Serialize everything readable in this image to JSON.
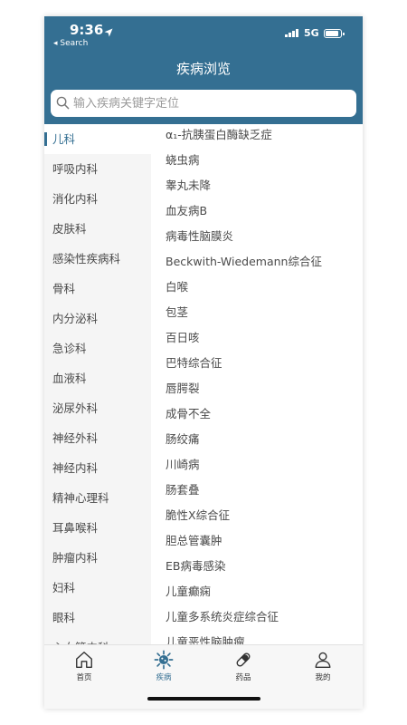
{
  "status_bar": {
    "time": "9:36",
    "back_app": "◂ Search",
    "network": "5G"
  },
  "header": {
    "title": "疾病浏览",
    "search": {
      "placeholder": "输入疾病关键字定位",
      "value": ""
    }
  },
  "sidebar": {
    "active": "儿科",
    "items": [
      {
        "label": "儿科"
      },
      {
        "label": "呼吸内科"
      },
      {
        "label": "消化内科"
      },
      {
        "label": "皮肤科"
      },
      {
        "label": "感染性疾病科"
      },
      {
        "label": "骨科"
      },
      {
        "label": "内分泌科"
      },
      {
        "label": "急诊科"
      },
      {
        "label": "血液科"
      },
      {
        "label": "泌尿外科"
      },
      {
        "label": "神经外科"
      },
      {
        "label": "神经内科"
      },
      {
        "label": "精神心理科"
      },
      {
        "label": "耳鼻喉科"
      },
      {
        "label": "肿瘤内科"
      },
      {
        "label": "妇科"
      },
      {
        "label": "眼科"
      },
      {
        "label": "心血管内科"
      }
    ]
  },
  "diseases": [
    "α₁-抗胰蛋白酶缺乏症",
    "蛲虫病",
    "睾丸未降",
    "血友病B",
    "病毒性脑膜炎",
    "Beckwith-Wiedemann综合征",
    "白喉",
    "包茎",
    "百日咳",
    "巴特综合征",
    "唇腭裂",
    "成骨不全",
    "肠绞痛",
    "川崎病",
    "肠套叠",
    "脆性X综合征",
    "胆总管囊肿",
    "EB病毒感染",
    "儿童癫痫",
    "儿童多系统炎症综合征",
    "儿童恶性脑肿瘤"
  ],
  "tabbar": {
    "active": "疾病",
    "tabs": [
      {
        "label": "首页",
        "icon": "home-icon"
      },
      {
        "label": "疾病",
        "icon": "virus-icon"
      },
      {
        "label": "药品",
        "icon": "pill-icon"
      },
      {
        "label": "我的",
        "icon": "person-icon"
      }
    ]
  },
  "colors": {
    "brand": "#346f92",
    "sidebar_bg": "#f5f5f5",
    "text": "#4a4a4a"
  }
}
